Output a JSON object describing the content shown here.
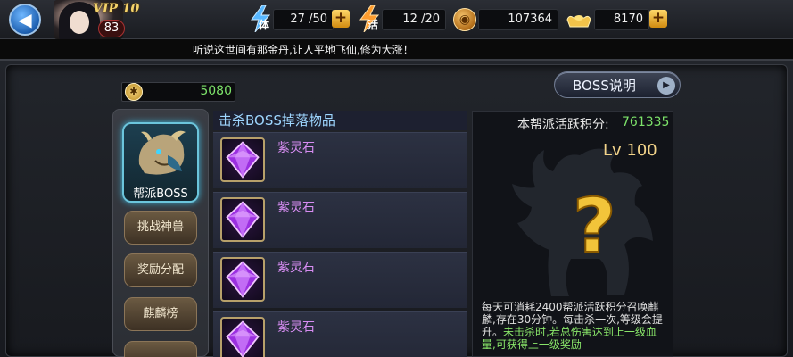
{
  "header": {
    "vip": "VIP 10",
    "level": "83",
    "stamina": {
      "icon": "lightning-icon",
      "char": "体",
      "value": "27 /50"
    },
    "activity": {
      "icon": "lightning-icon",
      "char": "活",
      "value": "12 /20"
    },
    "coins": {
      "icon": "coin-icon",
      "value": "107364"
    },
    "gold": {
      "icon": "gold-ingot-icon",
      "value": "8170"
    }
  },
  "marquee": "听说这世间有那金丹,让人平地飞仙,修为大涨！",
  "points": {
    "value": "5080"
  },
  "boss_explain_label": "BOSS说明",
  "nav": {
    "boss": "帮派BOSS",
    "challenge": "挑战神兽",
    "rewards": "奖励分配",
    "qilin": "麒麟榜"
  },
  "drops": {
    "title": "击杀BOSS掉落物品",
    "items": [
      {
        "name": "紫灵石"
      },
      {
        "name": "紫灵石"
      },
      {
        "name": "紫灵石"
      },
      {
        "name": "紫灵石"
      }
    ]
  },
  "info": {
    "activity_label": "本帮派活跃积分:",
    "activity_value": "761335",
    "lv": "Lv 100",
    "desc_normal": "每天可消耗2400帮派活跃积分召唤麒麟,存在30分钟。每击杀一次,等级会提升。",
    "desc_highlight": "未击杀时,若总伤害达到上一级血量,可获得上一级奖励"
  },
  "colors": {
    "accent_green": "#7de36a",
    "purple_item": "#d78df2",
    "gold": "#f3d48a"
  }
}
